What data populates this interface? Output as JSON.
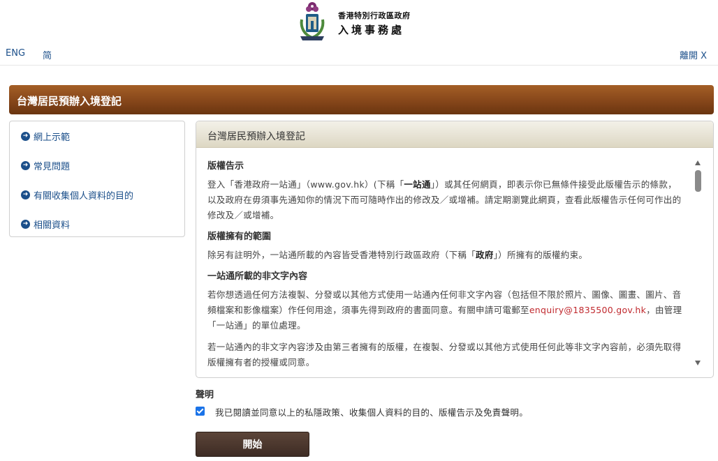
{
  "header": {
    "logo_line1": "香港特別行政區政府",
    "logo_line2": "入境事務處",
    "lang_english": "ENG",
    "lang_simplified": "简",
    "exit_label": "離開 X"
  },
  "page": {
    "title": "台灣居民預辦入境登記"
  },
  "sidebar": {
    "items": [
      {
        "label": "網上示範"
      },
      {
        "label": "常見問題"
      },
      {
        "label": "有關收集個人資料的目的"
      },
      {
        "label": "相關資料"
      }
    ]
  },
  "panel": {
    "header": "台灣居民預辦入境登記",
    "sec1_title": "版權告示",
    "sec1_p_a": "登入「香港政府一站通」（www.gov.hk）(下稱「",
    "sec1_p_b": "一站通",
    "sec1_p_c": "」）或其任何網頁，即表示你已無條件接受此版權告示的條款，以及政府在毋須事先通知你的情況下而可隨時作出的修改及／或增補。請定期瀏覽此網頁，查看此版權告示任何可作出的修改及／或增補。",
    "sec2_title": "版權擁有的範圍",
    "sec2_p_a": "除另有註明外，一站通所載的內容皆受香港特別行政區政府（下稱「",
    "sec2_p_b": "政府",
    "sec2_p_c": "」）所擁有的版權約束。",
    "sec3_title": "一站通所載的非文字內容",
    "sec3_p1_a": "若你想透過任何方法複製、分發或以其他方式使用一站通內任何非文字內容（包括但不限於照片、圖像、圖畫、圖片、音頻檔案和影像檔案）作任何用途，須事先得到政府的書面同意。有關申請可電郵至",
    "sec3_email": "enquiry@1835500.gov.hk",
    "sec3_p1_b": "，由管理「一站通」的單位處理。",
    "sec3_p2": "若一站通內的非文字內容涉及由第三者擁有的版權，在複製、分發或以其他方式使用任何此等非文字內容前，必須先取得版權擁有者的授權或同意。"
  },
  "declaration": {
    "title": "聲明",
    "checkbox_checked": true,
    "text": "我已閱讀並同意以上的私隱政策、收集個人資料的目的、版權告示及免責聲明。"
  },
  "start_button": {
    "label": "開始"
  },
  "icons": {
    "nav_item": "circle-arrow-right-icon",
    "logo": "hk-immigration-emblem-icon"
  },
  "colors": {
    "title_bar": "#86461a",
    "link": "#1b4f8a",
    "button": "#4a362c",
    "email": "#c0282d",
    "checkbox": "#1a73e8"
  }
}
